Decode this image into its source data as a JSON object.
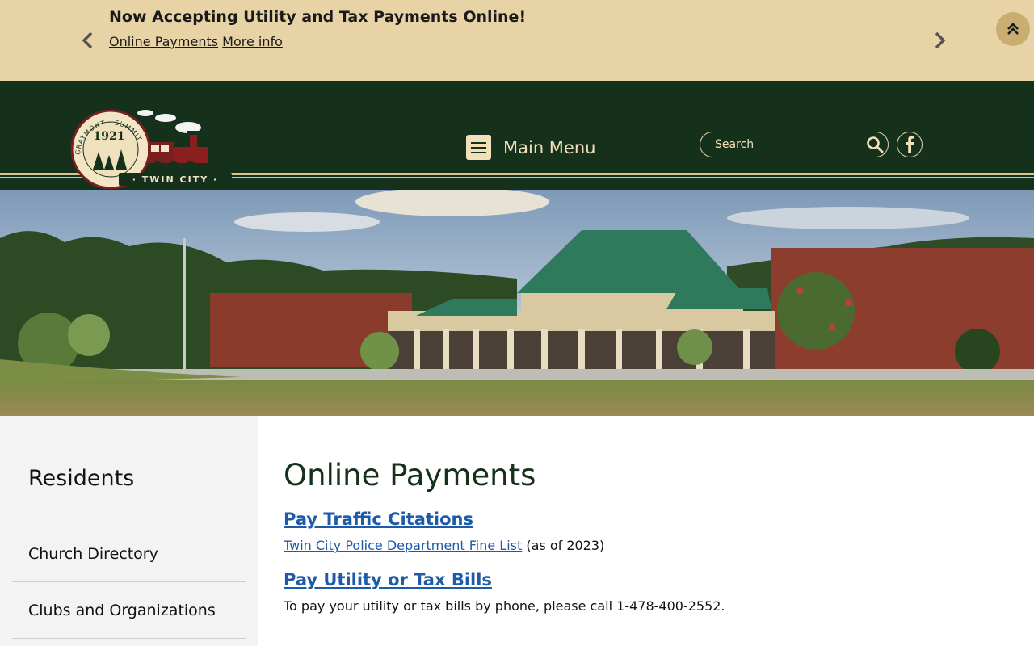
{
  "alert": {
    "title": "Now Accepting Utility and Tax Payments Online!",
    "link1": "Online Payments",
    "link2": "More info",
    "prev_icon": "chevron-left-icon",
    "next_icon": "chevron-right-icon",
    "scroll_top_icon": "double-chevron-up-icon"
  },
  "header": {
    "logo": {
      "year": "1921",
      "arc_text": "GRAYMONT · SUMMIT",
      "name": "· TWIN CITY ·"
    },
    "menu_label": "Main Menu",
    "search_placeholder": "Search",
    "search_icon": "search-icon",
    "social_icon": "facebook-icon"
  },
  "sidebar": {
    "title": "Residents",
    "items": [
      {
        "label": "Church Directory"
      },
      {
        "label": "Clubs and Organizations"
      }
    ]
  },
  "main": {
    "title": "Online Payments",
    "sections": [
      {
        "heading": "Pay Traffic Citations",
        "link_text": "Twin City Police Department Fine List",
        "suffix": "(as of 2023)"
      },
      {
        "heading": "Pay Utility or Tax Bills",
        "text": "To pay your utility or tax bills by phone, please call 1-478-400-2552."
      }
    ]
  },
  "colors": {
    "banner": "#e8d3a7",
    "header": "#15311b",
    "link": "#1d5aa8",
    "accent": "#f1e0b9"
  }
}
